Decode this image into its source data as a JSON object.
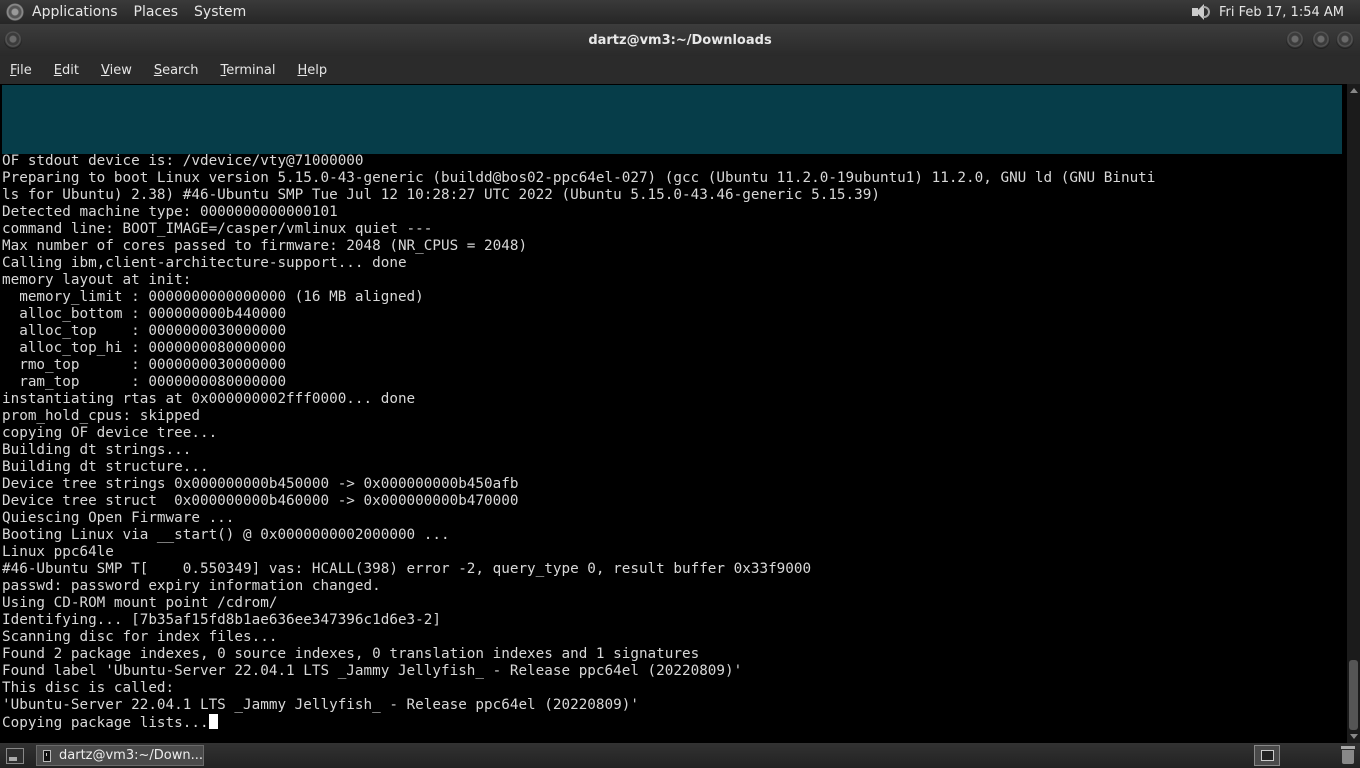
{
  "top_panel": {
    "menus": [
      "Applications",
      "Places",
      "System"
    ],
    "clock": "Fri Feb 17,  1:54 AM"
  },
  "window": {
    "title": "dartz@vm3:~/Downloads"
  },
  "menubar": {
    "file": {
      "mnemonic": "F",
      "rest": "ile"
    },
    "edit": {
      "mnemonic": "E",
      "rest": "dit"
    },
    "view": {
      "mnemonic": "V",
      "rest": "iew"
    },
    "search": {
      "mnemonic": "S",
      "rest": "earch"
    },
    "terminal": {
      "mnemonic": "T",
      "rest": "erminal"
    },
    "help": {
      "mnemonic": "H",
      "rest": "elp"
    }
  },
  "terminal": {
    "band_color": "#063d49",
    "lines": [
      "OF stdout device is: /vdevice/vty@71000000",
      "Preparing to boot Linux version 5.15.0-43-generic (buildd@bos02-ppc64el-027) (gcc (Ubuntu 11.2.0-19ubuntu1) 11.2.0, GNU ld (GNU Binuti",
      "ls for Ubuntu) 2.38) #46-Ubuntu SMP Tue Jul 12 10:28:27 UTC 2022 (Ubuntu 5.15.0-43.46-generic 5.15.39)",
      "Detected machine type: 0000000000000101",
      "command line: BOOT_IMAGE=/casper/vmlinux quiet ---",
      "Max number of cores passed to firmware: 2048 (NR_CPUS = 2048)",
      "Calling ibm,client-architecture-support... done",
      "memory layout at init:",
      "  memory_limit : 0000000000000000 (16 MB aligned)",
      "  alloc_bottom : 000000000b440000",
      "  alloc_top    : 0000000030000000",
      "  alloc_top_hi : 0000000080000000",
      "  rmo_top      : 0000000030000000",
      "  ram_top      : 0000000080000000",
      "instantiating rtas at 0x000000002fff0000... done",
      "prom_hold_cpus: skipped",
      "copying OF device tree...",
      "Building dt strings...",
      "Building dt structure...",
      "Device tree strings 0x000000000b450000 -> 0x000000000b450afb",
      "Device tree struct  0x000000000b460000 -> 0x000000000b470000",
      "Quiescing Open Firmware ...",
      "Booting Linux via __start() @ 0x0000000002000000 ...",
      "Linux ppc64le",
      "#46-Ubuntu SMP T[    0.550349] vas: HCALL(398) error -2, query_type 0, result buffer 0x33f9000",
      "passwd: password expiry information changed.",
      "Using CD-ROM mount point /cdrom/",
      "Identifying... [7b35af15fd8b1ae636ee347396c1d6e3-2]",
      "Scanning disc for index files...",
      "Found 2 package indexes, 0 source indexes, 0 translation indexes and 1 signatures",
      "Found label 'Ubuntu-Server 22.04.1 LTS _Jammy Jellyfish_ - Release ppc64el (20220809)'",
      "This disc is called:",
      "'Ubuntu-Server 22.04.1 LTS _Jammy Jellyfish_ - Release ppc64el (20220809)'",
      "Copying package lists..."
    ]
  },
  "taskbar": {
    "task_label": "dartz@vm3:~/Down..."
  }
}
